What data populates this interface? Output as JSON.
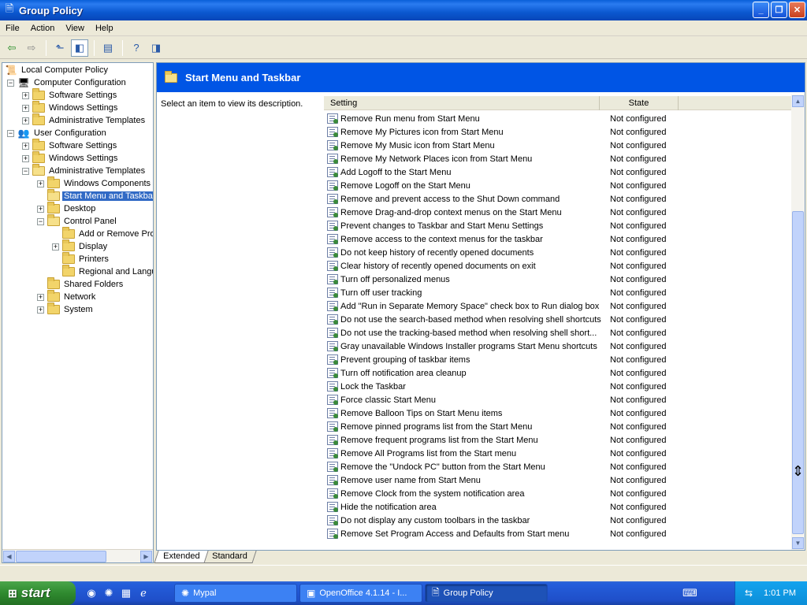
{
  "window": {
    "title": "Group Policy"
  },
  "menu": [
    "File",
    "Action",
    "View",
    "Help"
  ],
  "tree": {
    "root": "Local Computer Policy",
    "computer_config": "Computer Configuration",
    "cc_children": [
      "Software Settings",
      "Windows Settings",
      "Administrative Templates"
    ],
    "user_config": "User Configuration",
    "uc_children": [
      "Software Settings",
      "Windows Settings",
      "Administrative Templates"
    ],
    "admin_templates_children": {
      "windows_components": "Windows Components",
      "start_menu": "Start Menu and Taskba",
      "desktop": "Desktop",
      "control_panel": "Control Panel",
      "cp_children": [
        "Add or Remove Pro",
        "Display",
        "Printers",
        "Regional and Langu"
      ],
      "shared_folders": "Shared Folders",
      "network": "Network",
      "system": "System"
    }
  },
  "right": {
    "header_title": "Start Menu and Taskbar",
    "description": "Select an item to view its description.",
    "col_setting": "Setting",
    "col_state": "State"
  },
  "policies": [
    {
      "name": "Remove Run menu from Start Menu",
      "state": "Not configured"
    },
    {
      "name": "Remove My Pictures icon from Start Menu",
      "state": "Not configured"
    },
    {
      "name": "Remove My Music icon from Start Menu",
      "state": "Not configured"
    },
    {
      "name": "Remove My Network Places icon from Start Menu",
      "state": "Not configured"
    },
    {
      "name": "Add Logoff to the Start Menu",
      "state": "Not configured"
    },
    {
      "name": "Remove Logoff on the Start Menu",
      "state": "Not configured"
    },
    {
      "name": "Remove and prevent access to the Shut Down command",
      "state": "Not configured"
    },
    {
      "name": "Remove Drag-and-drop context menus on the Start Menu",
      "state": "Not configured"
    },
    {
      "name": "Prevent changes to Taskbar and Start Menu Settings",
      "state": "Not configured"
    },
    {
      "name": "Remove access to the context menus for the taskbar",
      "state": "Not configured"
    },
    {
      "name": "Do not keep history of recently opened documents",
      "state": "Not configured"
    },
    {
      "name": "Clear history of recently opened documents on exit",
      "state": "Not configured"
    },
    {
      "name": "Turn off personalized menus",
      "state": "Not configured"
    },
    {
      "name": "Turn off user tracking",
      "state": "Not configured"
    },
    {
      "name": "Add \"Run in Separate Memory Space\" check box to Run dialog box",
      "state": "Not configured"
    },
    {
      "name": "Do not use the search-based method when resolving shell shortcuts",
      "state": "Not configured"
    },
    {
      "name": "Do not use the tracking-based method when resolving shell short...",
      "state": "Not configured"
    },
    {
      "name": "Gray unavailable Windows Installer programs Start Menu shortcuts",
      "state": "Not configured"
    },
    {
      "name": "Prevent grouping of taskbar items",
      "state": "Not configured"
    },
    {
      "name": "Turn off notification area cleanup",
      "state": "Not configured"
    },
    {
      "name": "Lock the Taskbar",
      "state": "Not configured"
    },
    {
      "name": "Force classic Start Menu",
      "state": "Not configured"
    },
    {
      "name": "Remove Balloon Tips on Start Menu items",
      "state": "Not configured"
    },
    {
      "name": "Remove pinned programs list from the Start Menu",
      "state": "Not configured"
    },
    {
      "name": "Remove frequent programs list from the Start Menu",
      "state": "Not configured"
    },
    {
      "name": "Remove All Programs list from the Start menu",
      "state": "Not configured"
    },
    {
      "name": "Remove the \"Undock PC\" button from the Start Menu",
      "state": "Not configured"
    },
    {
      "name": "Remove user name from Start Menu",
      "state": "Not configured"
    },
    {
      "name": "Remove Clock from the system notification area",
      "state": "Not configured"
    },
    {
      "name": "Hide the notification area",
      "state": "Not configured"
    },
    {
      "name": "Do not display any custom toolbars in the taskbar",
      "state": "Not configured"
    },
    {
      "name": "Remove Set Program Access and Defaults from Start menu",
      "state": "Not configured"
    }
  ],
  "tabs": [
    "Extended",
    "Standard"
  ],
  "taskbar": {
    "start": "start",
    "tasks": [
      "Mypal",
      "OpenOffice 4.1.14 - I...",
      "Group Policy"
    ],
    "clock": "1:01 PM"
  }
}
